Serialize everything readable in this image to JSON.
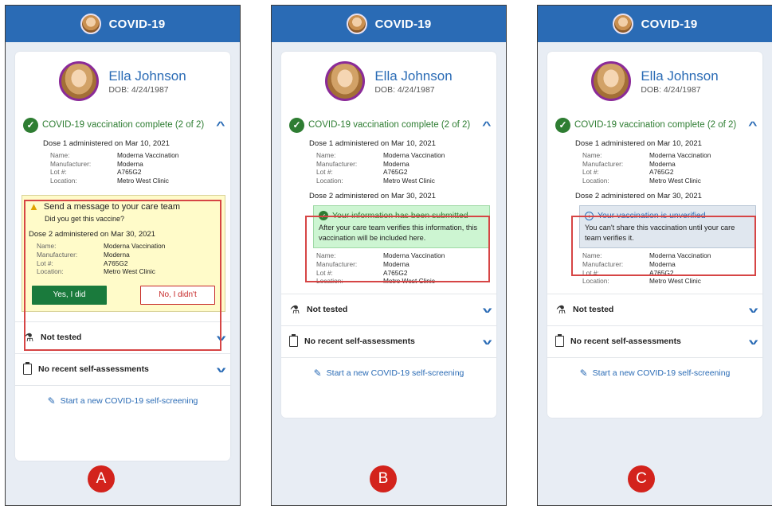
{
  "app_title": "COVID-19",
  "profile": {
    "name": "Ella Johnson",
    "dob": "DOB: 4/24/1987"
  },
  "vaccination": {
    "status": "COVID-19 vaccination complete (2 of 2)",
    "dose1": {
      "title": "Dose 1 administered on Mar 10, 2021",
      "fields": [
        {
          "label": "Name:",
          "value": "Moderna Vaccination"
        },
        {
          "label": "Manufacturer:",
          "value": "Moderna"
        },
        {
          "label": "Lot #:",
          "value": "A765G2"
        },
        {
          "label": "Location:",
          "value": "Metro West Clinic"
        }
      ]
    },
    "dose2": {
      "title": "Dose 2 administered on Mar 30, 2021",
      "fields": [
        {
          "label": "Name:",
          "value": "Moderna Vaccination"
        },
        {
          "label": "Manufacturer:",
          "value": "Moderna"
        },
        {
          "label": "Lot #:",
          "value": "A765G2"
        },
        {
          "label": "Location:",
          "value": "Metro West Clinic"
        }
      ]
    }
  },
  "panel_a": {
    "alert_title": "Send a message to your care team",
    "alert_question": "Did you get this vaccine?",
    "yes_label": "Yes, I did",
    "no_label": "No, I didn't",
    "badge": "A"
  },
  "panel_b": {
    "title": "Your information has been submitted",
    "body": "After your care team verifies this information, this vaccination will be included here.",
    "badge": "B"
  },
  "panel_c": {
    "title": "Your vaccination is unverified",
    "body": "You can't share this vaccination until your care team verifies it.",
    "badge": "C"
  },
  "rows": {
    "not_tested": "Not tested",
    "self_assess": "No recent self-assessments"
  },
  "screening_link": "Start a new COVID-19 self-screening",
  "colors": {
    "header": "#2a6bb5",
    "success": "#2e7d32",
    "alert_red": "#d64545",
    "badge": "#d3231c"
  }
}
